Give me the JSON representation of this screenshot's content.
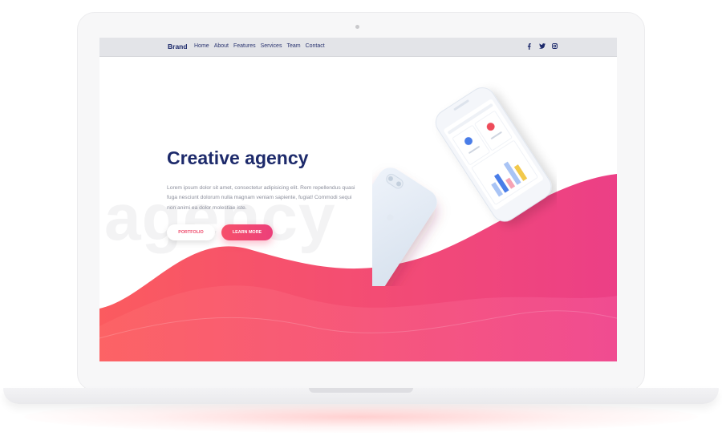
{
  "nav": {
    "brand": "Brand",
    "links": [
      "Home",
      "About",
      "Features",
      "Services",
      "Team",
      "Contact"
    ],
    "social_icons": [
      "facebook-icon",
      "twitter-icon",
      "instagram-icon"
    ]
  },
  "hero": {
    "title": "Creative agency",
    "background_word": "agency",
    "description": "Lorem ipsum dolor sit amet, consectetur adipisicing elit. Rem repellendus quasi fuga nesciunt dolorum nulla magnam veniam sapiente, fugiat! Commodi sequi non animi ea dolor molestiae iste.",
    "primary_button": "PORTFOLIO",
    "secondary_button": "LEARN MORE"
  },
  "colors": {
    "brand_navy": "#1d2a6b",
    "gradient_start": "#fb5b5f",
    "gradient_end": "#ec3f86",
    "nav_bg": "#e3e4e8"
  }
}
